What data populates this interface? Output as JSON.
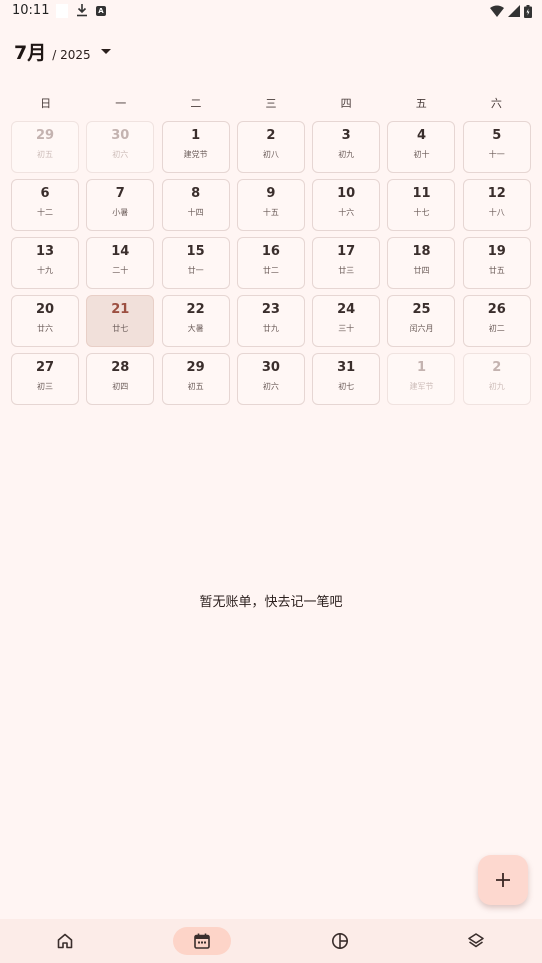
{
  "status_bar": {
    "time": "10:11"
  },
  "header": {
    "month": "7月",
    "year": "/ 2025"
  },
  "weekdays": [
    "日",
    "一",
    "二",
    "三",
    "四",
    "五",
    "六"
  ],
  "calendar": {
    "days": [
      {
        "num": "29",
        "lunar": "初五",
        "state": "faded"
      },
      {
        "num": "30",
        "lunar": "初六",
        "state": "faded"
      },
      {
        "num": "1",
        "lunar": "建党节",
        "state": "normal"
      },
      {
        "num": "2",
        "lunar": "初八",
        "state": "normal"
      },
      {
        "num": "3",
        "lunar": "初九",
        "state": "normal"
      },
      {
        "num": "4",
        "lunar": "初十",
        "state": "normal"
      },
      {
        "num": "5",
        "lunar": "十一",
        "state": "normal"
      },
      {
        "num": "6",
        "lunar": "十二",
        "state": "normal"
      },
      {
        "num": "7",
        "lunar": "小暑",
        "state": "normal"
      },
      {
        "num": "8",
        "lunar": "十四",
        "state": "normal"
      },
      {
        "num": "9",
        "lunar": "十五",
        "state": "normal"
      },
      {
        "num": "10",
        "lunar": "十六",
        "state": "normal"
      },
      {
        "num": "11",
        "lunar": "十七",
        "state": "normal"
      },
      {
        "num": "12",
        "lunar": "十八",
        "state": "normal"
      },
      {
        "num": "13",
        "lunar": "十九",
        "state": "normal"
      },
      {
        "num": "14",
        "lunar": "二十",
        "state": "normal"
      },
      {
        "num": "15",
        "lunar": "廿一",
        "state": "normal"
      },
      {
        "num": "16",
        "lunar": "廿二",
        "state": "normal"
      },
      {
        "num": "17",
        "lunar": "廿三",
        "state": "normal"
      },
      {
        "num": "18",
        "lunar": "廿四",
        "state": "normal"
      },
      {
        "num": "19",
        "lunar": "廿五",
        "state": "normal"
      },
      {
        "num": "20",
        "lunar": "廿六",
        "state": "normal"
      },
      {
        "num": "21",
        "lunar": "廿七",
        "state": "today"
      },
      {
        "num": "22",
        "lunar": "大暑",
        "state": "normal"
      },
      {
        "num": "23",
        "lunar": "廿九",
        "state": "normal"
      },
      {
        "num": "24",
        "lunar": "三十",
        "state": "normal"
      },
      {
        "num": "25",
        "lunar": "闰六月",
        "state": "normal"
      },
      {
        "num": "26",
        "lunar": "初二",
        "state": "normal"
      },
      {
        "num": "27",
        "lunar": "初三",
        "state": "normal"
      },
      {
        "num": "28",
        "lunar": "初四",
        "state": "normal"
      },
      {
        "num": "29",
        "lunar": "初五",
        "state": "normal"
      },
      {
        "num": "30",
        "lunar": "初六",
        "state": "normal"
      },
      {
        "num": "31",
        "lunar": "初七",
        "state": "normal"
      },
      {
        "num": "1",
        "lunar": "建军节",
        "state": "faded"
      },
      {
        "num": "2",
        "lunar": "初九",
        "state": "faded"
      }
    ]
  },
  "empty_message": "暂无账单，快去记一笔吧",
  "fab": {
    "icon": "plus-icon"
  },
  "bottom_nav": {
    "items": [
      {
        "icon": "home-icon",
        "active": false
      },
      {
        "icon": "calendar-icon",
        "active": true
      },
      {
        "icon": "pie-chart-icon",
        "active": false
      },
      {
        "icon": "layers-icon",
        "active": false
      }
    ]
  },
  "colors": {
    "background": "#fff5f3",
    "today_cell": "#f1e0da",
    "today_text": "#9c4f40",
    "fab": "#fdd8cf",
    "nav_active": "#fdd4c8"
  }
}
